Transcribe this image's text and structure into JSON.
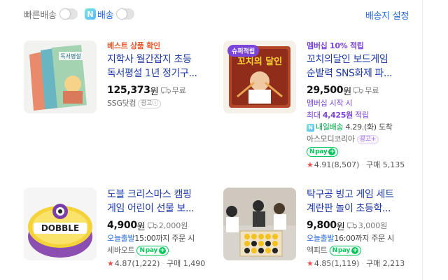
{
  "filters": {
    "fast_label": "빠른배송",
    "naver_label": "배송",
    "naver_icon": "N",
    "shipping_setting": "배송지 설정"
  },
  "products": [
    {
      "tag": "베스트 상품 확인",
      "title_line1": "지학사 월간잡지 초등",
      "title_line2": "독서평설 1년 정기구...",
      "price": "125,373",
      "won": "원",
      "shipping": "무료",
      "seller": "SSG닷컴",
      "ad": "광고ⓘ"
    },
    {
      "badge": "슈퍼적립",
      "tag": "멤버십 10% 적립",
      "title_line1": "꼬치의달인 보드게임",
      "title_line2": "순발력 SNS화제 파...",
      "price": "29,500",
      "won": "원",
      "shipping": "무료",
      "membership_start": "멤버십 시작 시",
      "max_points_prefix": "최대",
      "max_points": "4,425원",
      "max_points_suffix": "적립",
      "delivery_icon": "N",
      "delivery_label": "내일배송",
      "delivery_date": "4.29.(화) 도착",
      "seller": "아스모디코리아",
      "ad": "광고+",
      "npay": "pay",
      "rating": "4.91",
      "reviews": "(8,507)",
      "purchase_label": "구매",
      "purchases": "5,135"
    },
    {
      "tag": "",
      "title_line1": "도블 크리스마스 캠핑",
      "title_line2": "게임 어린이 선물 보...",
      "price": "4,900",
      "won": "원",
      "shipping": "2,000원",
      "dispatch_label": "오늘출발",
      "dispatch_time": "15:00까지 주문 시",
      "seller": "세바오트",
      "npay": "pay",
      "rating": "4.87",
      "reviews": "(1,222)",
      "purchase_label": "구매",
      "purchases": "1,490"
    },
    {
      "tag": "",
      "title_line1": "탁구공 빙고 게임 세트",
      "title_line2": "계란판 놀이 초등학...",
      "price": "9,800",
      "won": "원",
      "shipping": "3,000원",
      "dispatch_label": "오늘출발",
      "dispatch_time": "16:00까지 주문 시",
      "seller": "엑피트",
      "npay": "pay",
      "rating": "4.85",
      "reviews": "(1,119)",
      "purchase_label": "구매",
      "purchases": "2,213"
    }
  ],
  "thumbs": {
    "p1": "독서평설",
    "p2": "꼬치의 달인",
    "p3": "DOBBLE"
  },
  "colors": {
    "title_blue": "#1f3aa6",
    "accent_orange": "#e85b2e",
    "accent_purple": "#7a45d8",
    "naver_green": "#03c75a",
    "star_red": "#f14d4d"
  }
}
